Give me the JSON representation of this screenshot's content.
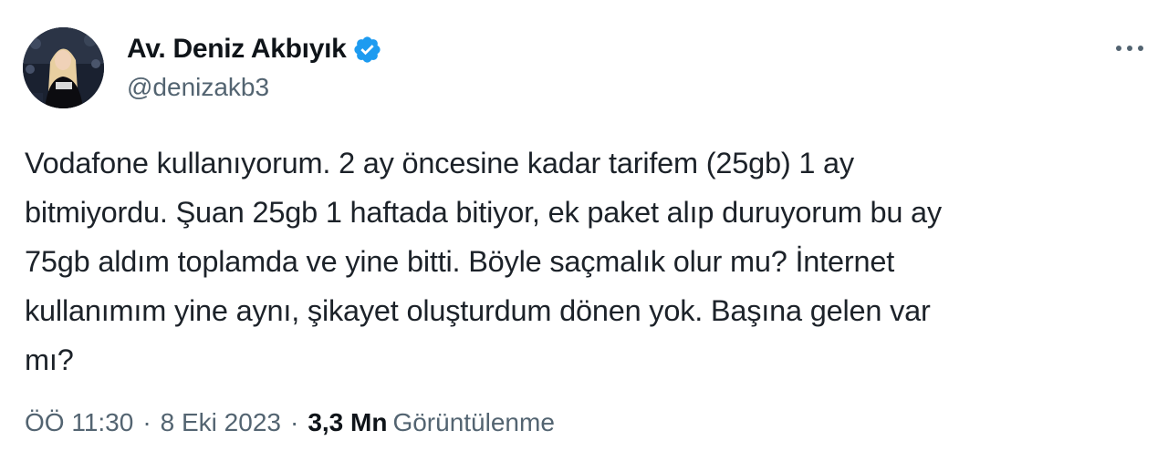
{
  "author": {
    "display_name": "Av. Deniz Akbıyık",
    "handle": "@denizakb3",
    "verified": true
  },
  "tweet": {
    "lines": [
      "Vodafone kullanıyorum. 2 ay öncesine kadar tarifem (25gb) 1 ay",
      "bitmiyordu. Şuan 25gb 1 haftada bitiyor, ek paket alıp duruyorum bu ay",
      "75gb aldım toplamda ve yine bitti. Böyle saçmalık olur mu? İnternet",
      "kullanımım yine aynı, şikayet oluşturdum dönen yok. Başına gelen var",
      "mı?"
    ]
  },
  "meta": {
    "time": "ÖÖ 11:30",
    "date": "8 Eki 2023",
    "separator": "·",
    "views_count": "3,3 Mn",
    "views_label": "Görüntülenme"
  },
  "colors": {
    "verified_badge": "#1d9bf0",
    "secondary_text": "#536471",
    "primary_text": "#0f1419"
  },
  "icons": {
    "more": "more-horizontal-icon",
    "verified": "verified-badge-icon"
  }
}
